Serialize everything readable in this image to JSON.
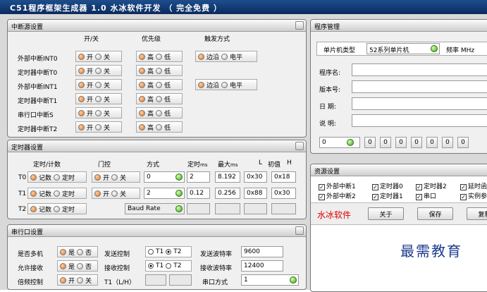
{
  "app": {
    "title": "C51程序框架生成器 1.0   水冰软件开发 （ 完全免费 ）"
  },
  "interrupt": {
    "title": "中断源设置",
    "col_onoff": "开/关",
    "col_priority": "优先级",
    "col_trigger": "触发方式",
    "rows": [
      "外部中断INT0",
      "定时器中断T0",
      "外部中断INT1",
      "定时器中断T1",
      "串行口中断S",
      "定时器中断T2"
    ],
    "on": "开",
    "off": "关",
    "high": "高",
    "low": "低",
    "edge": "边沿",
    "level": "电平"
  },
  "timer": {
    "title": "定时器设置",
    "col_mode": "定时/计数",
    "col_gate": "门控",
    "col_method": "方式",
    "col_time": "定时",
    "col_ms": "ms",
    "col_max": "最大",
    "col_max_ms": "ms",
    "col_l": "L",
    "col_init": "初值",
    "col_h": "H",
    "count": "记数",
    "timing": "定时",
    "open": "开",
    "close": "关",
    "t0": {
      "label": "T0",
      "method": "0",
      "time": "2",
      "max": "8.192",
      "l": "0x30",
      "h": "0x18"
    },
    "t1": {
      "label": "T1",
      "method": "2",
      "time": "0.12",
      "max": "0.256",
      "l": "0x88",
      "h": "0x30"
    },
    "t2": {
      "label": "T2",
      "baud": "Baud Rate"
    }
  },
  "serial": {
    "title": "串行口设置",
    "multi": "是否多机",
    "yes": "是",
    "no": "否",
    "recv_allow": "允许接收",
    "double": "倍频控制",
    "open": "开",
    "close": "关",
    "t1lh": "T1（L/H）",
    "send_ctrl": "发送控制",
    "recv_ctrl": "接收控制",
    "t1": "T1",
    "t2": "T2",
    "send_baud_label": "发送波特率",
    "send_baud": "9600",
    "recv_baud_label": "接收波特率",
    "recv_baud": "12400",
    "port_mode_label": "串口方式",
    "port_mode": "1"
  },
  "program": {
    "title": "程序管理",
    "mcu_label": "单片机类型",
    "mcu_value": "52系列单片机",
    "freq_label": "频率 MHz",
    "name_label": "程序名:",
    "version_label": "版本号:",
    "date_label": "日  期:",
    "desc_label": "说  明:",
    "bit_start": "0",
    "bits": [
      "0",
      "0",
      "0",
      "0",
      "0",
      "0",
      "0"
    ]
  },
  "resource": {
    "title": "资源设置",
    "row1": [
      "外部中断1",
      "定时器0",
      "定时器2",
      "延时函"
    ],
    "row2": [
      "外部中断2",
      "定时器1",
      "串口",
      "实例参"
    ],
    "brand": "水冰软件",
    "about": "关于",
    "save": "保存",
    "copy": "复制"
  },
  "watermark": "最需教育"
}
